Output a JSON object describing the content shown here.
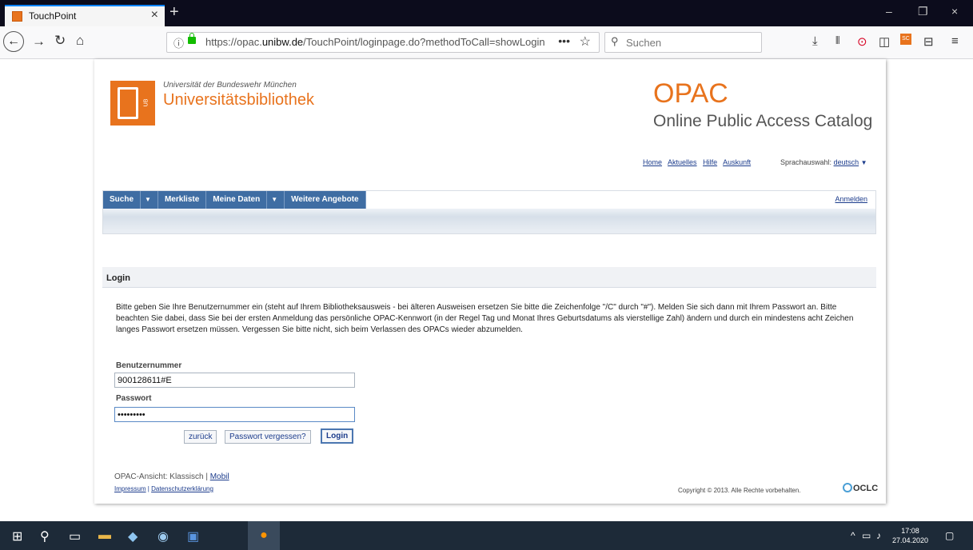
{
  "browser": {
    "tab_title": "TouchPoint",
    "tab_close": "×",
    "new_tab": "+",
    "window_controls": {
      "minimize": "–",
      "restore": "❐",
      "close": "×"
    },
    "url_prefix": "https://opac.",
    "url_domain": "unibw.de",
    "url_path": "/TouchPoint/loginpage.do?methodToCall=showLogin",
    "url_more": "•••",
    "search_placeholder": "Suchen",
    "icons": [
      "back-icon",
      "forward-icon",
      "reload-icon",
      "home-icon",
      "info-icon",
      "lock-icon",
      "star-icon",
      "download-icon",
      "library-icon",
      "extension-icon",
      "sidebar-icon",
      "sc-extension-icon",
      "tab-icon",
      "menu-icon"
    ]
  },
  "header": {
    "uni_small": "Universität der Bundeswehr München",
    "uni_big": "Universitätsbibliothek",
    "logo_text": "UB",
    "opac_title": "OPAC",
    "opac_subtitle": "Online Public Access Catalog",
    "links": [
      "Home",
      "Aktuelles",
      "Hilfe",
      "Auskunft"
    ],
    "lang_label": "Sprachauswahl:",
    "lang_value": "deutsch"
  },
  "menu": {
    "items": [
      "Suche",
      "Merkliste",
      "Meine Daten",
      "Weitere Angebote"
    ],
    "anmelden": "Anmelden"
  },
  "login": {
    "heading": "Login",
    "intro": "Bitte geben Sie Ihre Benutzernummer ein (steht auf Ihrem Bibliotheksausweis - bei älteren Ausweisen ersetzen Sie bitte die Zeichenfolge \"/C\" durch \"#\"). Melden Sie sich dann mit Ihrem Passwort an. Bitte beachten Sie dabei, dass Sie bei der ersten Anmeldung das persönliche OPAC-Kennwort (in der Regel Tag und Monat Ihres Geburtsdatums als vierstellige Zahl) ändern und durch ein mindestens acht Zeichen langes Passwort ersetzen müssen. Vergessen Sie bitte nicht, sich beim Verlassen des OPACs wieder abzumelden.",
    "user_label": "Benutzernummer",
    "user_value": "900128611#E",
    "pass_label": "Passwort",
    "pass_value": "•••••••••",
    "btn_back": "zurück",
    "btn_forgot": "Passwort vergessen?",
    "btn_login": "Login"
  },
  "footer": {
    "ansicht_label": "OPAC-Ansicht:",
    "ansicht_current": "Klassisch",
    "ansicht_sep": "|",
    "ansicht_mobile": "Mobil",
    "impressum": "Impressum",
    "datenschutz": "Datenschutzerklärung",
    "copyright": "Copyright © 2013. Alle Rechte vorbehalten.",
    "oclc": "OCLC"
  },
  "taskbar": {
    "time": "17:08",
    "date": "27.04.2020"
  }
}
